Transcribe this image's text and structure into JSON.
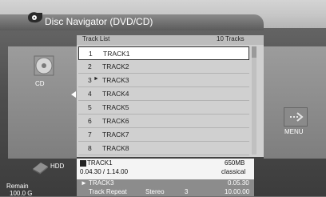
{
  "window": {
    "title": "Disc Navigator (DVD/CD)"
  },
  "list": {
    "header_label": "Track List",
    "count": "10 Tracks",
    "rows": [
      {
        "num": "1",
        "marker": "",
        "name": "TRACK1"
      },
      {
        "num": "2",
        "marker": "",
        "name": "TRACK2"
      },
      {
        "num": "3",
        "marker": "►",
        "name": "TRACK3"
      },
      {
        "num": "4",
        "marker": "",
        "name": "TRACK4"
      },
      {
        "num": "5",
        "marker": "",
        "name": "TRACK5"
      },
      {
        "num": "6",
        "marker": "",
        "name": "TRACK6"
      },
      {
        "num": "7",
        "marker": "",
        "name": "TRACK7"
      },
      {
        "num": "8",
        "marker": "",
        "name": "TRACK8"
      }
    ]
  },
  "left_panel": {
    "label": "CD",
    "icon": "cd-icon"
  },
  "right_panel": {
    "label": "MENU",
    "icon": "menu-icon"
  },
  "info": {
    "name": "TRACK1",
    "time": "0.04.30 / 1.14.00",
    "size": "650MB",
    "genre": "classical"
  },
  "playback": {
    "track": "► TRACK3",
    "time": "0.05.30",
    "repeat": "Track Repeat",
    "audio": "Stereo",
    "number": "3",
    "time2": "10.00.00"
  },
  "hdd": {
    "label": "HDD",
    "remain_label": "Remain",
    "remain_value": "100.0 G"
  }
}
